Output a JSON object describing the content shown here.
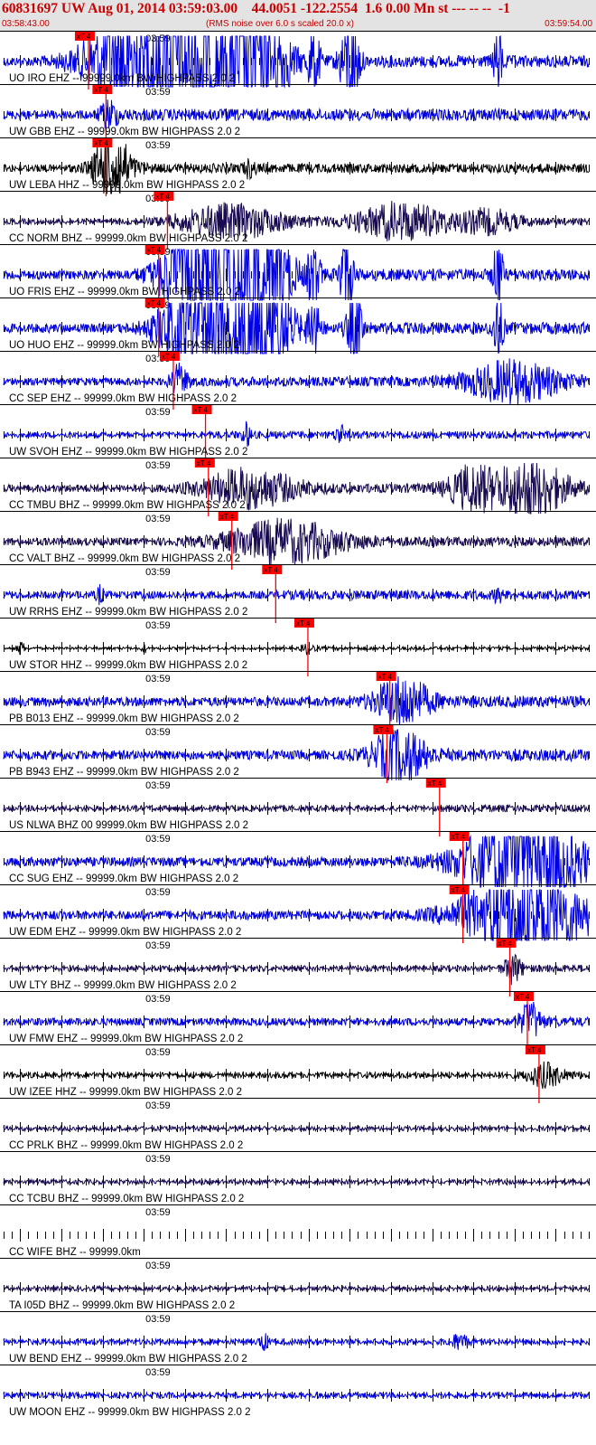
{
  "header": {
    "title": "60831697 UW Aug 01, 2014 03:59:03.00    44.0051 -122.2554  1.6 0.00 Mn st --- -- --  -1",
    "start_time": "03:58:43.00",
    "note": "(RMS noise over 6.0 s scaled 20.0 x)",
    "end_time": "03:59:54.00"
  },
  "colors": {
    "blue": "#0000e6",
    "navy": "#1a0a52",
    "black": "#000000",
    "pick": "#ff0000",
    "header_text": "#c80000",
    "header_bg": "#e3e3e3"
  },
  "chart_data": {
    "type": "line",
    "title": "60831697 UW Aug 01, 2014 03:59:03.00    44.0051 -122.2554  1.6 0.00 Mn st --- -- --  -1",
    "time_range": [
      "03:58:43.00",
      "03:59:54.00"
    ],
    "minute_tick_label": "03:59",
    "pick_label": "xT 4",
    "traces": [
      {
        "label": "UO IRO EHZ -- 99999.0km BW  HIGHPASS  2.0  2",
        "color": "#0000e6",
        "amp": 5,
        "pick": 0.145,
        "pick_label": "xT 4",
        "bursts": [
          [
            0.22,
            0.08,
            55
          ],
          [
            0.31,
            0.07,
            55
          ],
          [
            0.39,
            0.06,
            50
          ],
          [
            0.45,
            0.04,
            50
          ],
          [
            0.53,
            0.01,
            40
          ],
          [
            0.585,
            0.012,
            40
          ],
          [
            0.6,
            0.01,
            35
          ],
          [
            0.845,
            0.008,
            35
          ]
        ]
      },
      {
        "label": "UW GBB EHZ -- 99999.0km BW  HIGHPASS  2.0  2",
        "color": "#0000e6",
        "amp": 5,
        "pick": 0.175,
        "pick_label": "xT 4",
        "bursts": [
          [
            0.18,
            0.015,
            14
          ]
        ]
      },
      {
        "label": "UW LEBA HHZ -- 99999.0km BW  HIGHPASS  2.0  2",
        "color": "#000000",
        "amp": 4,
        "pick": 0.175,
        "pick_label": "xT 4",
        "bursts": [
          [
            0.185,
            0.03,
            42
          ],
          [
            0.42,
            0.01,
            8
          ]
        ]
      },
      {
        "label": "CC NORM BHZ -- 99999.0km BW  HIGHPASS  2.0  2",
        "color": "#1a0a52",
        "amp": 3,
        "pick": 0.28,
        "pick_label": "xT 4",
        "bursts": [
          [
            0.39,
            0.09,
            18
          ],
          [
            0.68,
            0.08,
            20
          ],
          [
            0.83,
            0.05,
            12
          ]
        ]
      },
      {
        "label": "UO FRIS EHZ -- 99999.0km BW  HIGHPASS  2.0  2",
        "color": "#0000e6",
        "amp": 5,
        "pick": 0.265,
        "pick_label": "xT 4",
        "bursts": [
          [
            0.33,
            0.06,
            55
          ],
          [
            0.4,
            0.06,
            55
          ],
          [
            0.45,
            0.04,
            50
          ],
          [
            0.53,
            0.01,
            40
          ],
          [
            0.585,
            0.012,
            45
          ],
          [
            0.845,
            0.008,
            40
          ]
        ]
      },
      {
        "label": "UO HUO EHZ -- 99999.0km BW  HIGHPASS  2.0  2",
        "color": "#0000e6",
        "amp": 5,
        "pick": 0.265,
        "pick_label": "xT 4",
        "bursts": [
          [
            0.33,
            0.06,
            55
          ],
          [
            0.4,
            0.06,
            55
          ],
          [
            0.45,
            0.04,
            50
          ],
          [
            0.53,
            0.01,
            40
          ],
          [
            0.6,
            0.012,
            45
          ],
          [
            0.845,
            0.008,
            40
          ]
        ]
      },
      {
        "label": "CC SEP EHZ -- 99999.0km BW  HIGHPASS  2.0  2",
        "color": "#0000e6",
        "amp": 4,
        "pick": 0.29,
        "pick_label": "xT 4",
        "bursts": [
          [
            0.3,
            0.015,
            16
          ],
          [
            0.87,
            0.08,
            22
          ]
        ]
      },
      {
        "label": "UW SVOH EHZ -- 99999.0km BW  HIGHPASS  2.0  2",
        "color": "#0000e6",
        "amp": 3,
        "pick": 0.345,
        "pick_label": "xT 4",
        "bursts": [
          [
            0.415,
            0.008,
            12
          ],
          [
            0.575,
            0.008,
            10
          ]
        ]
      },
      {
        "label": "CC TMBU BHZ -- 99999.0km BW  HIGHPASS  2.0  2",
        "color": "#1a0a52",
        "amp": 4,
        "pick": 0.35,
        "pick_label": "xT 4",
        "bursts": [
          [
            0.42,
            0.08,
            20
          ],
          [
            0.8,
            0.04,
            22
          ],
          [
            0.9,
            0.06,
            32
          ]
        ]
      },
      {
        "label": "CC VALT BHZ -- 99999.0km BW  HIGHPASS  2.0  2",
        "color": "#1a0a52",
        "amp": 4,
        "pick": 0.39,
        "pick_label": "xT 4",
        "bursts": [
          [
            0.48,
            0.1,
            22
          ]
        ]
      },
      {
        "label": "UW RRHS EHZ -- 99999.0km BW  HIGHPASS  2.0  2",
        "color": "#0000e6",
        "amp": 4,
        "pick": 0.465,
        "pick_label": "xT 4",
        "bursts": [
          [
            0.165,
            0.006,
            9
          ],
          [
            0.845,
            0.006,
            8
          ]
        ]
      },
      {
        "label": "UW STOR HHZ -- 99999.0km BW  HIGHPASS  2.0  2",
        "color": "#000000",
        "amp": 1.5,
        "pick": 0.52,
        "pick_label": "xT 4",
        "bursts": [
          [
            0.03,
            0.006,
            8
          ],
          [
            0.24,
            0.004,
            5
          ],
          [
            0.52,
            0.01,
            6
          ]
        ]
      },
      {
        "label": "PB B013 EHZ -- 99999.0km BW  HIGHPASS  2.0  2",
        "color": "#0000e6",
        "amp": 5,
        "pick": 0.66,
        "pick_label": "xT 4",
        "bursts": [
          [
            0.68,
            0.045,
            28
          ]
        ]
      },
      {
        "label": "PB B943 EHZ -- 99999.0km BW  HIGHPASS  2.0  2",
        "color": "#0000e6",
        "amp": 5,
        "pick": 0.655,
        "pick_label": "xT 4",
        "bursts": [
          [
            0.675,
            0.045,
            30
          ]
        ]
      },
      {
        "label": "US NLWA BHZ 00 99999.0km BW  HIGHPASS  2.0  2",
        "color": "#1a0a52",
        "amp": 3,
        "pick": 0.745,
        "pick_label": "xT 4",
        "bursts": []
      },
      {
        "label": "CC SUG EHZ -- 99999.0km BW  HIGHPASS  2.0  2",
        "color": "#0000e6",
        "amp": 5,
        "pick": 0.785,
        "pick_label": "xT 4",
        "bursts": [
          [
            0.89,
            0.1,
            55
          ]
        ]
      },
      {
        "label": "UW EDM EHZ -- 99999.0km BW  HIGHPASS  2.0  2",
        "color": "#0000e6",
        "amp": 5,
        "pick": 0.785,
        "pick_label": "xT 4",
        "bursts": [
          [
            0.89,
            0.1,
            55
          ]
        ]
      },
      {
        "label": "UW LTY BHZ -- 99999.0km BW  HIGHPASS  2.0  2",
        "color": "#1a0a52",
        "amp": 3,
        "pick": 0.865,
        "pick_label": "xT 4",
        "bursts": [
          [
            0.87,
            0.015,
            16
          ]
        ]
      },
      {
        "label": "UW FMW EHZ -- 99999.0km BW  HIGHPASS  2.0  2",
        "color": "#0000e6",
        "amp": 4,
        "pick": 0.895,
        "pick_label": "xT 4",
        "bursts": [
          [
            0.9,
            0.018,
            20
          ]
        ]
      },
      {
        "label": "UW IZEE HHZ -- 99999.0km BW  HIGHPASS  2.0  2",
        "color": "#000000",
        "amp": 3,
        "pick": 0.915,
        "pick_label": "xT 4",
        "bursts": [
          [
            0.925,
            0.03,
            12
          ]
        ]
      },
      {
        "label": "CC PRLK BHZ -- 99999.0km BW  HIGHPASS  2.0  2",
        "color": "#1a0a52",
        "amp": 2.5,
        "pick": null,
        "bursts": []
      },
      {
        "label": "CC TCBU BHZ -- 99999.0km BW  HIGHPASS  2.0  2",
        "color": "#1a0a52",
        "amp": 2.5,
        "pick": null,
        "bursts": []
      },
      {
        "label": "CC WIFE BHZ -- 99999.0km",
        "color": "#1a0a52",
        "amp": 0,
        "pick": null,
        "bursts": []
      },
      {
        "label": "TA I05D BHZ -- 99999.0km BW  HIGHPASS  2.0  2",
        "color": "#1a0a52",
        "amp": 2.5,
        "pick": null,
        "bursts": []
      },
      {
        "label": "UW BEND EHZ -- 99999.0km BW  HIGHPASS  2.0  2",
        "color": "#0000e6",
        "amp": 3,
        "pick": null,
        "bursts": [
          [
            0.445,
            0.008,
            8
          ],
          [
            0.78,
            0.015,
            9
          ]
        ]
      },
      {
        "label": "UW MOON EHZ -- 99999.0km BW  HIGHPASS  2.0  2",
        "color": "#0000e6",
        "amp": 3,
        "pick": null,
        "bursts": []
      }
    ]
  }
}
